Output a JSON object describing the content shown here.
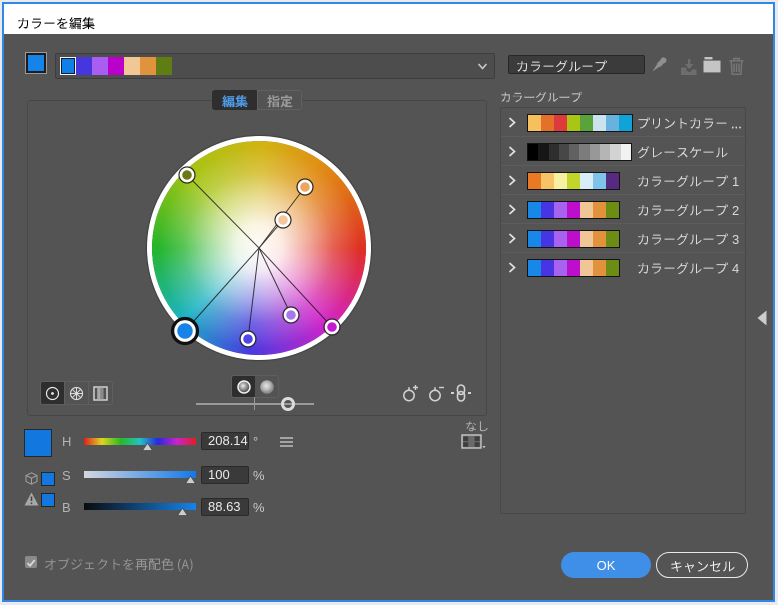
{
  "window": {
    "title": "カラーを編集",
    "accent_border_color": "#3187e3"
  },
  "toolbar": {
    "base_color": "#1583e8",
    "active_group_swatches": [
      "#1080e8",
      "#4636e0",
      "#a85ef0",
      "#bb00cc",
      "#f0c795",
      "#e0923d",
      "#5f7d12"
    ],
    "group_name_field": {
      "value": "カラーグループ",
      "placeholder": ""
    },
    "edit_icon": "pencil",
    "save_icon": "save-group",
    "folder_icon": "new-color-group",
    "trash_icon": "delete-color-group"
  },
  "tabs": {
    "edit_label": "編集",
    "assign_label": "指定",
    "active": "編集"
  },
  "wheel": {
    "base_handle_color": "#1583e8",
    "handle_colors": [
      "#6b7a15",
      "#efa55f",
      "#f3c79b",
      "#a678ee",
      "#4f46e8",
      "#c618d2",
      "#1583e8"
    ],
    "mode_buttons": [
      "smooth-color-wheel",
      "segmented-color-wheel",
      "color-bars"
    ],
    "selected_mode": "smooth-color-wheel",
    "display_toggles": [
      "show-saturation",
      "show-brightness"
    ],
    "selected_toggle": "show-saturation"
  },
  "hsb": {
    "h": {
      "label": "H",
      "value": "208.14",
      "unit": "°"
    },
    "s": {
      "label": "S",
      "value": "100",
      "unit": "%"
    },
    "b": {
      "label": "B",
      "value": "88.63",
      "unit": "%"
    }
  },
  "limit_library": {
    "value": "なし",
    "icon": "swatch-library-grid"
  },
  "groups": {
    "label": "カラーグループ",
    "name_prefix": "カラーグループ",
    "items": [
      {
        "name": "プリントカラー ...",
        "colors": [
          "#f6c05c",
          "#e4702a",
          "#dd3b3b",
          "#a8c613",
          "#58a33a",
          "#cbe3ee",
          "#68b2de",
          "#0fa3da"
        ]
      },
      {
        "name": "グレースケール",
        "colors": [
          "#000000",
          "#161616",
          "#2e2e2e",
          "#474747",
          "#616161",
          "#7c7c7c",
          "#989898",
          "#b5b5b5",
          "#d3d3d3",
          "#f2f2f2"
        ]
      },
      {
        "name": "カラーグループ 1",
        "num": "1",
        "colors": [
          "#e87a23",
          "#f7c366",
          "#f7f0a3",
          "#c0d62b",
          "#d8edf8",
          "#7fc3ea",
          "#572a82"
        ]
      },
      {
        "name": "カラーグループ 2",
        "num": "2",
        "colors": [
          "#1787e8",
          "#4734e3",
          "#a763f0",
          "#bc0ecc",
          "#f0c696",
          "#e2923c",
          "#6c8c14"
        ]
      },
      {
        "name": "カラーグループ 3",
        "num": "3",
        "colors": [
          "#1787e8",
          "#4734e3",
          "#a763f0",
          "#bc0ecc",
          "#f0c696",
          "#e2923c",
          "#6c8c14"
        ]
      },
      {
        "name": "カラーグループ 4",
        "num": "4",
        "colors": [
          "#1787e8",
          "#4734e3",
          "#a763f0",
          "#bc0ecc",
          "#f0c696",
          "#e2923c",
          "#6c8c14"
        ]
      }
    ]
  },
  "footer": {
    "recolor_checkbox_label": "オブジェクトを再配色 (A)",
    "recolor_checkbox_checked": true,
    "ok_label": "OK",
    "cancel_label": "キャンセル"
  }
}
